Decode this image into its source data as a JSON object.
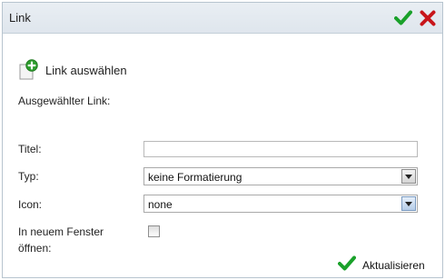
{
  "dialog": {
    "title": "Link"
  },
  "header_actions": {
    "confirm_icon": "checkmark-icon",
    "close_icon": "close-x-icon"
  },
  "link_picker": {
    "label": "Link auswählen",
    "icon": "document-add-icon"
  },
  "selected_link": {
    "label": "Ausgewählter Link:"
  },
  "form": {
    "title_label": "Titel:",
    "title_value": "",
    "type_label": "Typ:",
    "type_value": "keine Formatierung",
    "icon_label": "Icon:",
    "icon_value": "none",
    "new_window_label_line1": "In neuem Fenster",
    "new_window_label_line2": "öffnen:",
    "new_window_checked": false
  },
  "update_button": {
    "label": "Aktualisieren",
    "icon": "checkmark-icon"
  },
  "colors": {
    "check_green": "#1aa12a",
    "close_red": "#c8161b",
    "titlebar_bg": "#e3e9ef"
  }
}
